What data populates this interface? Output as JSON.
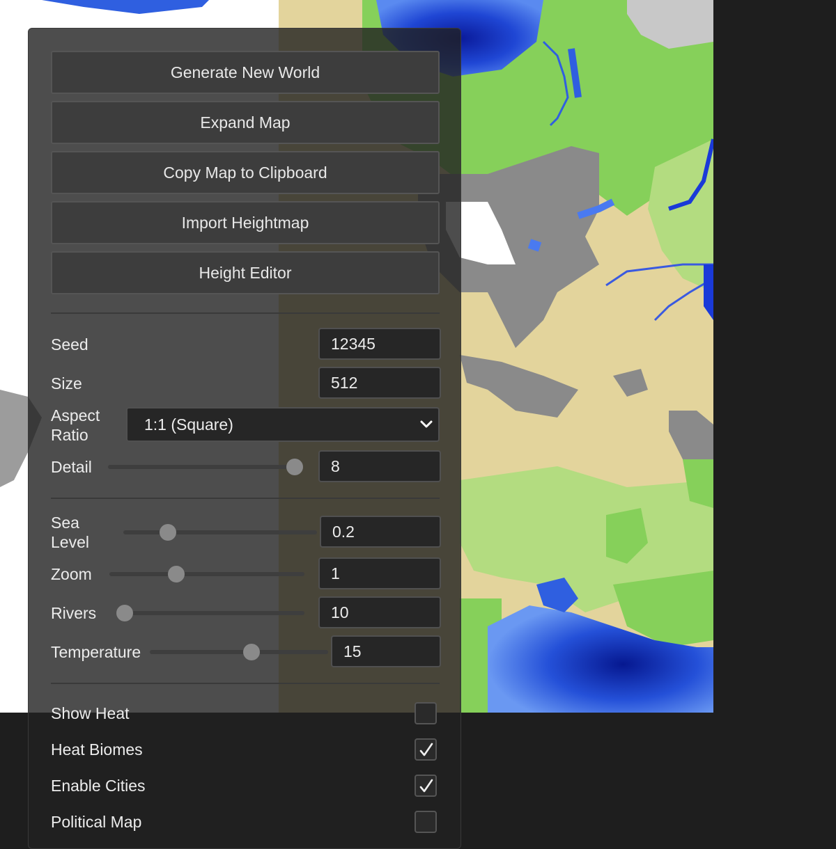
{
  "buttons": {
    "generate": "Generate New World",
    "expand": "Expand Map",
    "copy": "Copy Map to Clipboard",
    "import": "Import Heightmap",
    "height_editor": "Height Editor"
  },
  "settings": {
    "seed": {
      "label": "Seed",
      "value": "12345"
    },
    "size": {
      "label": "Size",
      "value": "512"
    },
    "aspect_ratio": {
      "label_line1": "Aspect",
      "label_line2": "Ratio",
      "selected": "1:1 (Square)"
    },
    "detail": {
      "label": "Detail",
      "value": "8",
      "slider_fraction": 0.9
    },
    "sea_level": {
      "label_line1": "Sea",
      "label_line2": "Level",
      "value": "0.2",
      "slider_fraction": 0.23
    },
    "zoom": {
      "label": "Zoom",
      "value": "1",
      "slider_fraction": 0.34
    },
    "rivers": {
      "label": "Rivers",
      "value": "10",
      "slider_fraction": 0.0
    },
    "temperature": {
      "label": "Temperature",
      "value": "15",
      "slider_fraction": 0.57
    }
  },
  "toggles": {
    "show_heat": {
      "label": "Show Heat",
      "checked": false
    },
    "heat_biomes": {
      "label": "Heat Biomes",
      "checked": true
    },
    "enable_cities": {
      "label": "Enable Cities",
      "checked": true
    },
    "political_map": {
      "label": "Political Map",
      "checked": false
    }
  },
  "icons": {
    "dropdown": "chevron-down-icon",
    "checkmark": "checkmark-icon"
  },
  "colors": {
    "panel_bg": "#202020",
    "button_bg": "#3d3d3d",
    "grass": "#86d05a",
    "light_grass": "#b3dc80",
    "sand": "#e3d49c",
    "mountain": "#8a8a8a",
    "snow": "#ffffff",
    "water_deep": "#0a2ab0",
    "water": "#2f5fe0"
  }
}
